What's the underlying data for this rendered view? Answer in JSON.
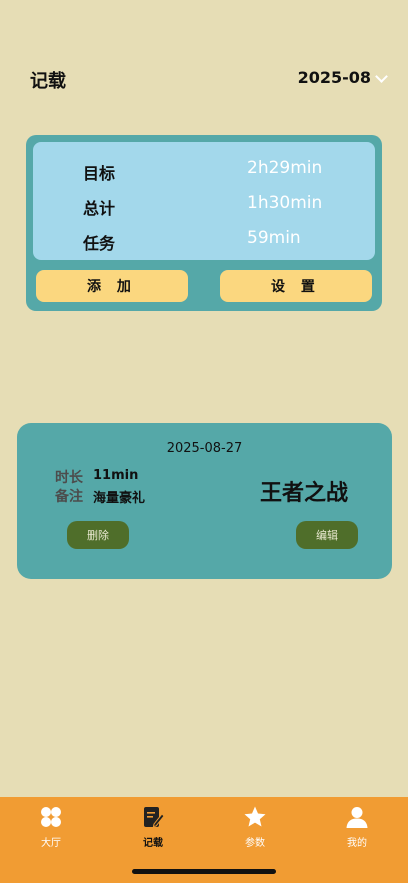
{
  "header": {
    "title": "记载",
    "month": "2025-08"
  },
  "summary": {
    "rows": [
      {
        "label": "目标",
        "value": "2h29min"
      },
      {
        "label": "总计",
        "value": "1h30min"
      },
      {
        "label": "任务",
        "value": "59min"
      }
    ],
    "add_label": "添 加",
    "settings_label": "设 置"
  },
  "record": {
    "date": "2025-08-27",
    "duration_label": "时长",
    "duration_value": "11min",
    "note_label": "备注",
    "note_value": "海量豪礼",
    "name": "王者之战",
    "delete_label": "删除",
    "edit_label": "编辑"
  },
  "tabs": [
    {
      "label": "大厅",
      "icon": "clover-icon"
    },
    {
      "label": "记载",
      "icon": "note-edit-icon"
    },
    {
      "label": "参数",
      "icon": "star-icon"
    },
    {
      "label": "我的",
      "icon": "user-icon"
    }
  ],
  "colors": {
    "background": "#E6DDB5",
    "card": "#55A8A8",
    "card_inner": "#A3D8EB",
    "button_yellow": "#FBD77F",
    "button_green": "#4F6E2A",
    "tabbar": "#F19C33"
  }
}
